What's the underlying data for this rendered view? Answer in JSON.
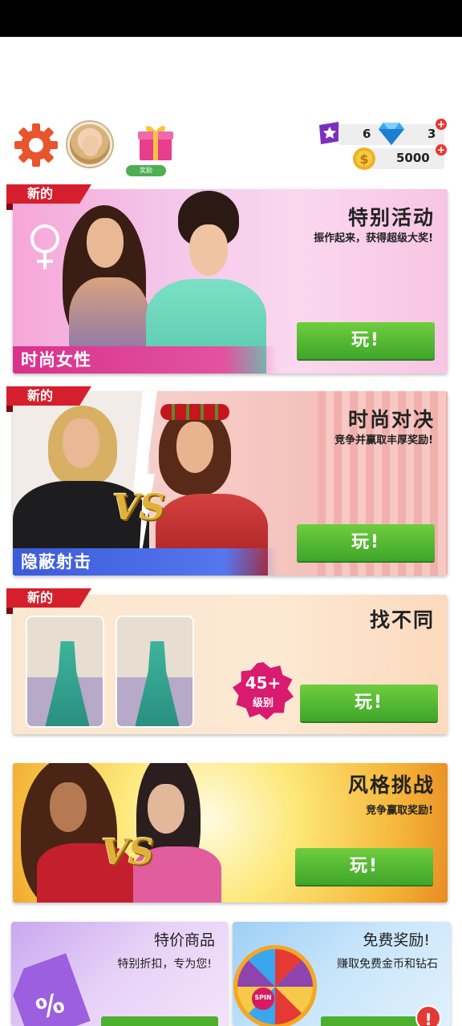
{
  "header": {
    "gift_label": "奖励",
    "stars": "6",
    "diamonds": "3",
    "coins": "5000",
    "plus_symbol": "+",
    "icons": [
      "gear-icon",
      "avatar",
      "gift-icon",
      "star-ticket-icon",
      "diamond-icon",
      "coin-icon"
    ]
  },
  "cards": [
    {
      "new_tag": "新的",
      "title": "特别活动",
      "subtitle": "振作起来，获得超级大奖!",
      "category": "时尚女性",
      "play": "玩!"
    },
    {
      "new_tag": "新的",
      "title": "时尚对决",
      "subtitle": "竞争并赢取丰厚奖励!",
      "category": "隐蔽射击",
      "play": "玩!",
      "vs": "VS"
    },
    {
      "new_tag": "新的",
      "title": "找不同",
      "level_number": "45+",
      "level_text": "级别",
      "play": "玩!"
    },
    {
      "title": "风格挑战",
      "subtitle": "竞争赢取奖励!",
      "play": "玩!",
      "vs": "VS"
    }
  ],
  "bottom": {
    "sale_title": "特价商品",
    "sale_sub": "特别折扣，专为您!",
    "sale_tag": "%",
    "free_title": "免费奖励!",
    "free_sub": "赚取免费金币和钻石",
    "spin": "SPIN",
    "alert": "!"
  },
  "colors": {
    "play_green": "#4caf2e",
    "new_red": "#d61f2c",
    "category_pink": "#d9318c",
    "category_blue": "#3b5bd9"
  }
}
